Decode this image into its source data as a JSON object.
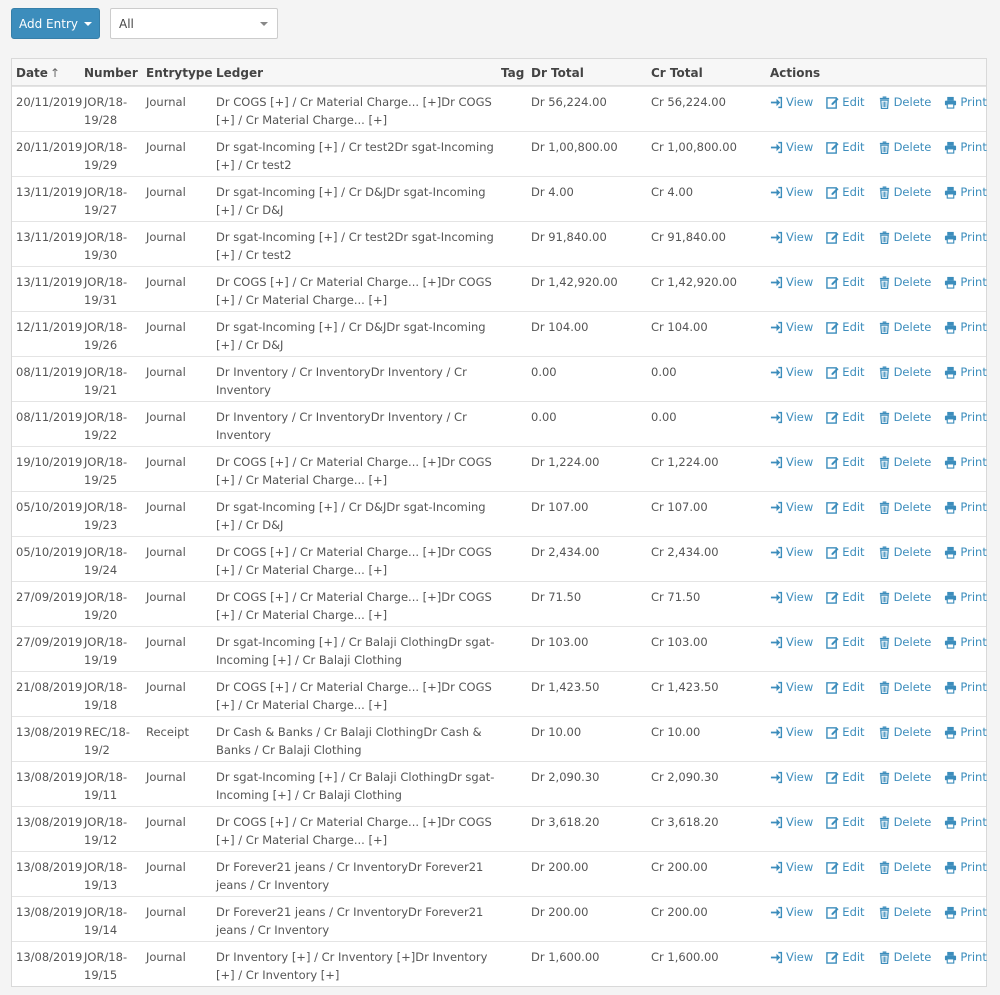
{
  "toolbar": {
    "add_entry_label": "Add Entry",
    "filter_value": "All"
  },
  "table": {
    "headers": {
      "date": "Date",
      "date_sort": "↑",
      "number": "Number",
      "entrytype": "Entrytype",
      "ledger": "Ledger",
      "tag": "Tag",
      "dr_total": "Dr Total",
      "cr_total": "Cr Total",
      "actions": "Actions"
    },
    "action_labels": {
      "view": "View",
      "edit": "Edit",
      "delete": "Delete",
      "print": "Print"
    },
    "rows": [
      {
        "date": "20/11/2019",
        "number": "JOR/18-19/28",
        "type": "Journal",
        "ledger": "Dr COGS [+] / Cr Material Charge... [+]Dr COGS [+] / Cr Material Charge... [+]",
        "dr": "Dr 56,224.00",
        "cr": "Cr 56,224.00"
      },
      {
        "date": "20/11/2019",
        "number": "JOR/18-19/29",
        "type": "Journal",
        "ledger": "Dr sgat-Incoming [+] / Cr test2Dr sgat-Incoming [+] / Cr test2",
        "dr": "Dr 1,00,800.00",
        "cr": "Cr 1,00,800.00"
      },
      {
        "date": "13/11/2019",
        "number": "JOR/18-19/27",
        "type": "Journal",
        "ledger": "Dr sgat-Incoming [+] / Cr D&JDr sgat-Incoming [+] / Cr D&J",
        "dr": "Dr 4.00",
        "cr": "Cr 4.00"
      },
      {
        "date": "13/11/2019",
        "number": "JOR/18-19/30",
        "type": "Journal",
        "ledger": "Dr sgat-Incoming [+] / Cr test2Dr sgat-Incoming [+] / Cr test2",
        "dr": "Dr 91,840.00",
        "cr": "Cr 91,840.00"
      },
      {
        "date": "13/11/2019",
        "number": "JOR/18-19/31",
        "type": "Journal",
        "ledger": "Dr COGS [+] / Cr Material Charge... [+]Dr COGS [+] / Cr Material Charge... [+]",
        "dr": "Dr 1,42,920.00",
        "cr": "Cr 1,42,920.00"
      },
      {
        "date": "12/11/2019",
        "number": "JOR/18-19/26",
        "type": "Journal",
        "ledger": "Dr sgat-Incoming [+] / Cr D&JDr sgat-Incoming [+] / Cr D&J",
        "dr": "Dr 104.00",
        "cr": "Cr 104.00"
      },
      {
        "date": "08/11/2019",
        "number": "JOR/18-19/21",
        "type": "Journal",
        "ledger": "Dr Inventory / Cr InventoryDr Inventory / Cr Inventory",
        "dr": "0.00",
        "cr": "0.00"
      },
      {
        "date": "08/11/2019",
        "number": "JOR/18-19/22",
        "type": "Journal",
        "ledger": "Dr Inventory / Cr InventoryDr Inventory / Cr Inventory",
        "dr": "0.00",
        "cr": "0.00"
      },
      {
        "date": "19/10/2019",
        "number": "JOR/18-19/25",
        "type": "Journal",
        "ledger": "Dr COGS [+] / Cr Material Charge... [+]Dr COGS [+] / Cr Material Charge... [+]",
        "dr": "Dr 1,224.00",
        "cr": "Cr 1,224.00"
      },
      {
        "date": "05/10/2019",
        "number": "JOR/18-19/23",
        "type": "Journal",
        "ledger": "Dr sgat-Incoming [+] / Cr D&JDr sgat-Incoming [+] / Cr D&J",
        "dr": "Dr 107.00",
        "cr": "Cr 107.00"
      },
      {
        "date": "05/10/2019",
        "number": "JOR/18-19/24",
        "type": "Journal",
        "ledger": "Dr COGS [+] / Cr Material Charge... [+]Dr COGS [+] / Cr Material Charge... [+]",
        "dr": "Dr 2,434.00",
        "cr": "Cr 2,434.00"
      },
      {
        "date": "27/09/2019",
        "number": "JOR/18-19/20",
        "type": "Journal",
        "ledger": "Dr COGS [+] / Cr Material Charge... [+]Dr COGS [+] / Cr Material Charge... [+]",
        "dr": "Dr 71.50",
        "cr": "Cr 71.50"
      },
      {
        "date": "27/09/2019",
        "number": "JOR/18-19/19",
        "type": "Journal",
        "ledger": "Dr sgat-Incoming [+] / Cr Balaji ClothingDr sgat-Incoming [+] / Cr Balaji Clothing",
        "dr": "Dr 103.00",
        "cr": "Cr 103.00"
      },
      {
        "date": "21/08/2019",
        "number": "JOR/18-19/18",
        "type": "Journal",
        "ledger": "Dr COGS [+] / Cr Material Charge... [+]Dr COGS [+] / Cr Material Charge... [+]",
        "dr": "Dr 1,423.50",
        "cr": "Cr 1,423.50"
      },
      {
        "date": "13/08/2019",
        "number": "REC/18-19/2",
        "type": "Receipt",
        "ledger": "Dr Cash & Banks / Cr Balaji ClothingDr Cash & Banks / Cr Balaji Clothing",
        "dr": "Dr 10.00",
        "cr": "Cr 10.00"
      },
      {
        "date": "13/08/2019",
        "number": "JOR/18-19/11",
        "type": "Journal",
        "ledger": "Dr sgat-Incoming [+] / Cr Balaji ClothingDr sgat-Incoming [+] / Cr Balaji Clothing",
        "dr": "Dr 2,090.30",
        "cr": "Cr 2,090.30"
      },
      {
        "date": "13/08/2019",
        "number": "JOR/18-19/12",
        "type": "Journal",
        "ledger": "Dr COGS [+] / Cr Material Charge... [+]Dr COGS [+] / Cr Material Charge... [+]",
        "dr": "Dr 3,618.20",
        "cr": "Cr 3,618.20"
      },
      {
        "date": "13/08/2019",
        "number": "JOR/18-19/13",
        "type": "Journal",
        "ledger": "Dr Forever21 jeans / Cr InventoryDr Forever21 jeans / Cr Inventory",
        "dr": "Dr 200.00",
        "cr": "Cr 200.00"
      },
      {
        "date": "13/08/2019",
        "number": "JOR/18-19/14",
        "type": "Journal",
        "ledger": "Dr Forever21 jeans / Cr InventoryDr Forever21 jeans / Cr Inventory",
        "dr": "Dr 200.00",
        "cr": "Cr 200.00"
      },
      {
        "date": "13/08/2019",
        "number": "JOR/18-19/15",
        "type": "Journal",
        "ledger": "Dr Inventory [+] / Cr Inventory [+]Dr Inventory [+] / Cr Inventory [+]",
        "dr": "Dr 1,600.00",
        "cr": "Cr 1,600.00"
      }
    ]
  }
}
